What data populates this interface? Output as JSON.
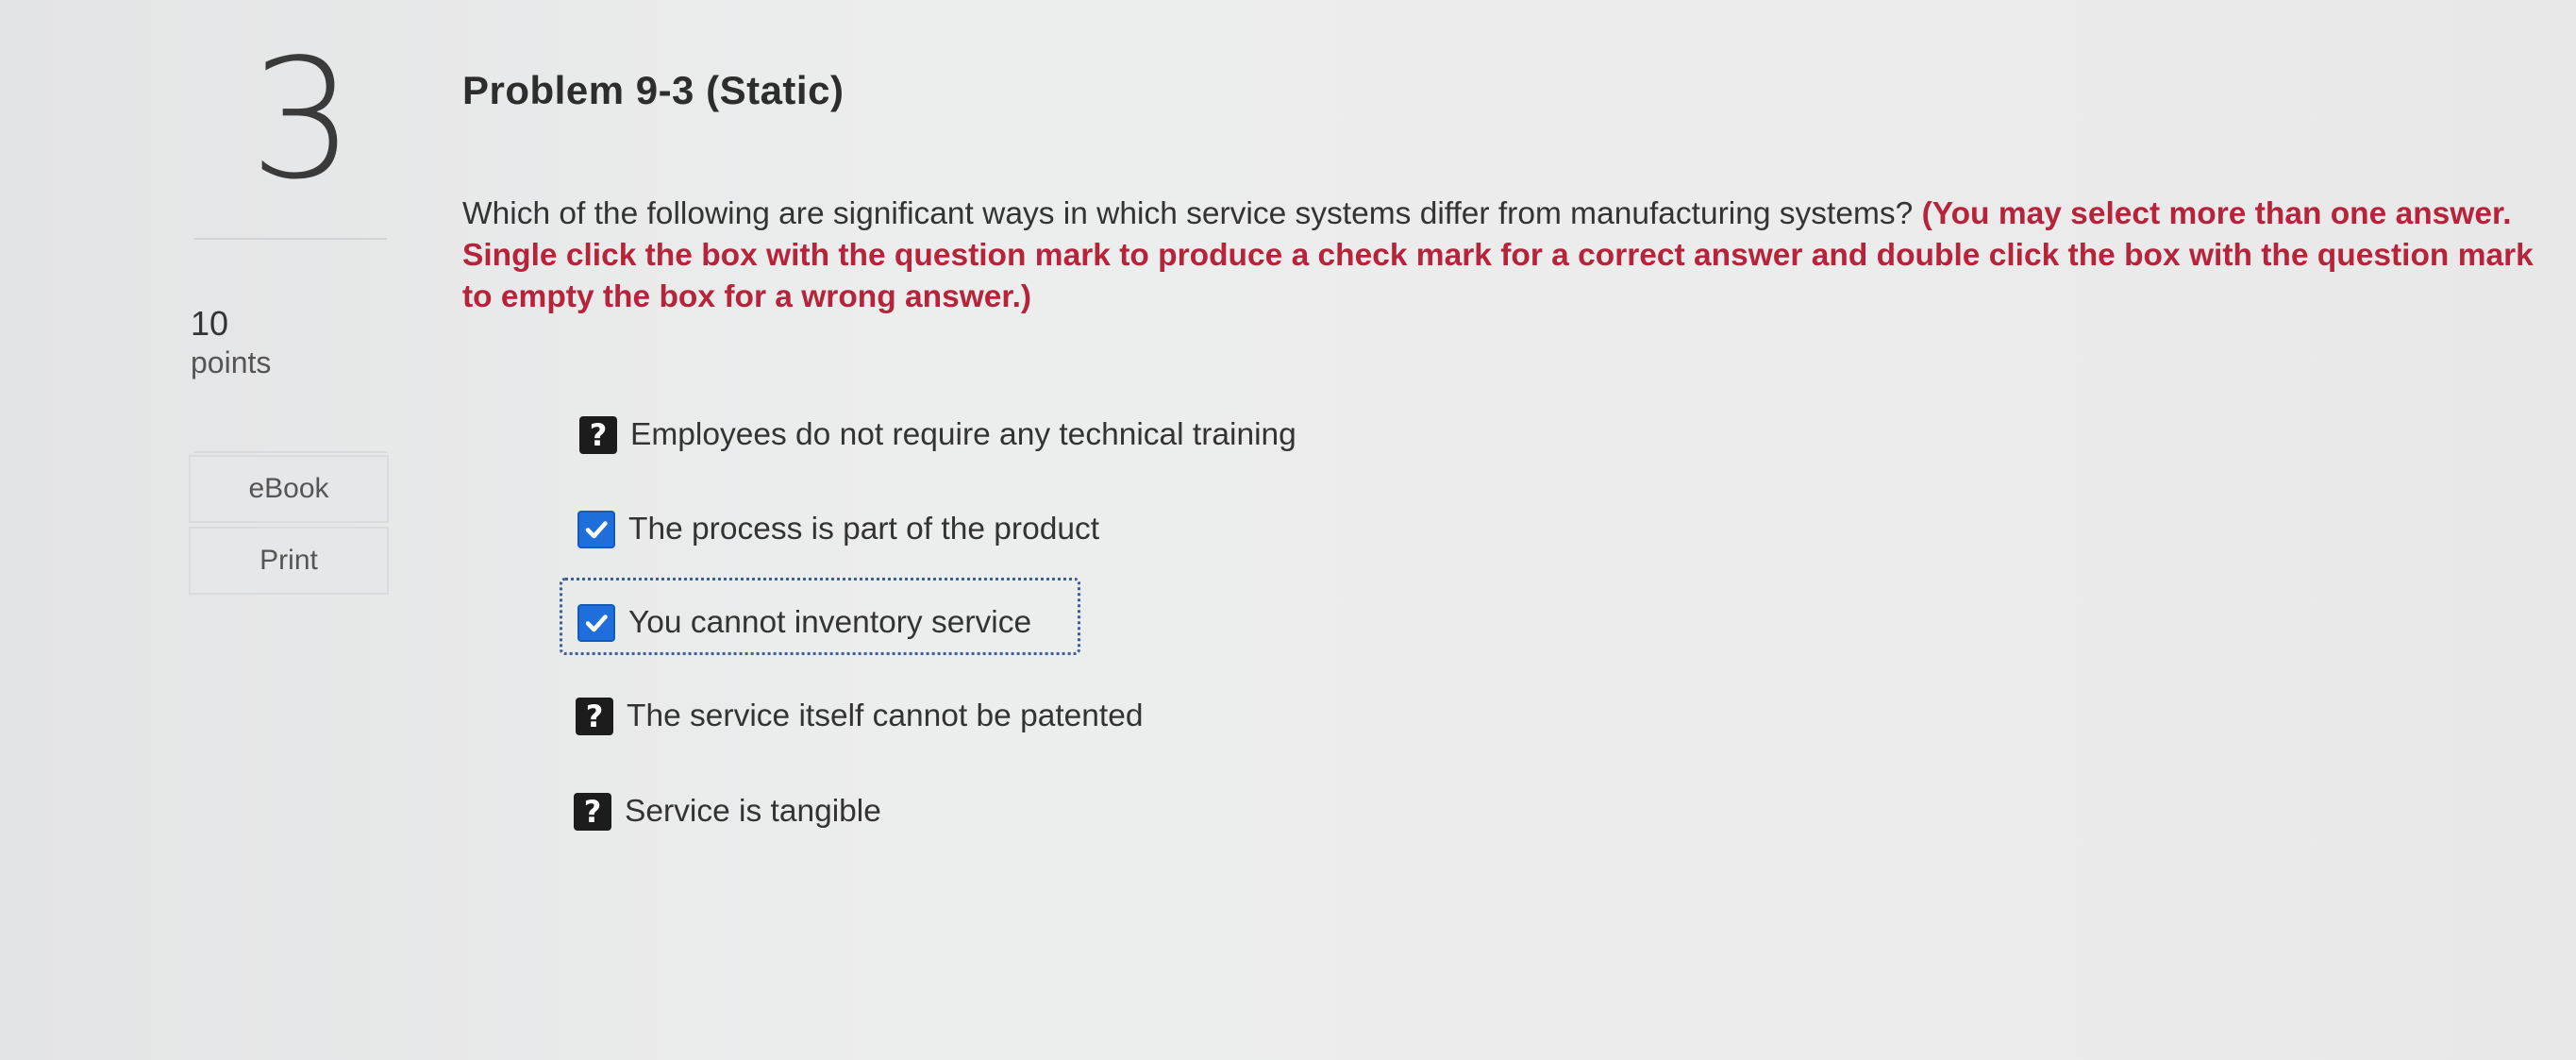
{
  "question": {
    "number": "3",
    "points_value": "10",
    "points_label": "points",
    "title": "Problem 9-3 (Static)",
    "prompt": "Which of the following are significant ways in which service systems differ from manufacturing systems?",
    "instructions": "(You may select more than one answer. Single click the box with the question mark to produce a check mark for a correct answer and double click the box with the question mark to empty the box for a wrong answer.)"
  },
  "sidebar": {
    "ebook_label": "eBook",
    "print_label": "Print"
  },
  "options": [
    {
      "label": "Employees do not require any technical training",
      "state": "unknown",
      "icon": "question-mark-icon"
    },
    {
      "label": "The process is part of the product",
      "state": "checked",
      "icon": "check-icon"
    },
    {
      "label": "You cannot inventory service",
      "state": "checked",
      "icon": "check-icon",
      "focused": true
    },
    {
      "label": "The service itself cannot be patented",
      "state": "unknown",
      "icon": "question-mark-icon"
    },
    {
      "label": "Service is tangible",
      "state": "unknown",
      "icon": "question-mark-icon"
    }
  ],
  "colors": {
    "instructions": "#b5243a",
    "checkbox_checked": "#1e6fdc",
    "checkbox_unknown": "#1c1c1c"
  }
}
